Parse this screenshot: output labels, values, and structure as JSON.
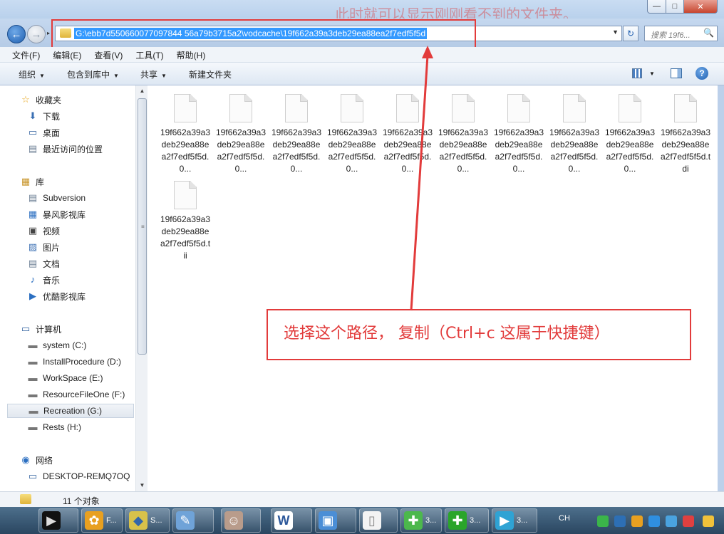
{
  "window": {
    "background_caption": "此时就可以显示刚刚看不到的文件夹。",
    "min_glyph": "—",
    "max_glyph": "□",
    "close_glyph": "✕"
  },
  "nav": {
    "back_glyph": "←",
    "forward_glyph": "→",
    "history_glyph": "▸",
    "address": "G:\\ebb7d550660077097844 56a79b3715a2\\vodcache\\19f662a39a3deb29ea88ea2f7edf5f5d",
    "address_dropdown": "▼",
    "refresh_glyph": "↻",
    "search_placeholder": "搜索 19f6...",
    "search_glyph": "🔍"
  },
  "menu": [
    "文件(F)",
    "编辑(E)",
    "查看(V)",
    "工具(T)",
    "帮助(H)"
  ],
  "toolbar": {
    "organize": "组织",
    "include_in_library": "包含到库中",
    "share": "共享",
    "new_folder": "新建文件夹",
    "arrow": "▼",
    "view_arrow": "▼",
    "help_glyph": "?"
  },
  "sidebar": {
    "favorites": {
      "label": "收藏夹",
      "icon": "☆"
    },
    "favorites_items": [
      {
        "label": "下载",
        "icon": "⬇"
      },
      {
        "label": "桌面",
        "icon": "▭"
      },
      {
        "label": "最近访问的位置",
        "icon": "▤"
      }
    ],
    "libraries": {
      "label": "库",
      "icon": "▦"
    },
    "library_items": [
      {
        "label": "Subversion",
        "icon": "▤"
      },
      {
        "label": "暴风影视库",
        "icon": "▦"
      },
      {
        "label": "视频",
        "icon": "▣"
      },
      {
        "label": "图片",
        "icon": "▨"
      },
      {
        "label": "文档",
        "icon": "▤"
      },
      {
        "label": "音乐",
        "icon": "♪"
      },
      {
        "label": "优酷影视库",
        "icon": "▶"
      }
    ],
    "computer": {
      "label": "计算机",
      "icon": "▭"
    },
    "drives": [
      {
        "label": "system (C:)",
        "icon": "▬"
      },
      {
        "label": "InstallProcedure (D:)",
        "icon": "▬"
      },
      {
        "label": "WorkSpace (E:)",
        "icon": "▬"
      },
      {
        "label": "ResourceFileOne (F:)",
        "icon": "▬"
      },
      {
        "label": "Recreation (G:)",
        "icon": "▬"
      },
      {
        "label": "Rests (H:)",
        "icon": "▬"
      }
    ],
    "network": {
      "label": "网络",
      "icon": "◉"
    },
    "network_items": [
      {
        "label": "DESKTOP-REMQ7OQ",
        "icon": "▭"
      }
    ],
    "scroll_up": "▲",
    "scroll_down": "▼",
    "scroll_grip": "≡"
  },
  "files": [
    "19f662a39a3deb29ea88ea2f7edf5f5d.0...",
    "19f662a39a3deb29ea88ea2f7edf5f5d.0...",
    "19f662a39a3deb29ea88ea2f7edf5f5d.0...",
    "19f662a39a3deb29ea88ea2f7edf5f5d.0...",
    "19f662a39a3deb29ea88ea2f7edf5f5d.0...",
    "19f662a39a3deb29ea88ea2f7edf5f5d.0...",
    "19f662a39a3deb29ea88ea2f7edf5f5d.0...",
    "19f662a39a3deb29ea88ea2f7edf5f5d.0...",
    "19f662a39a3deb29ea88ea2f7edf5f5d.0...",
    "19f662a39a3deb29ea88ea2f7edf5f5d.tdi",
    "19f662a39a3deb29ea88ea2f7edf5f5d.tii"
  ],
  "status": {
    "text": "11 个对象"
  },
  "annotation": {
    "text": "选择这个路径，  复制（Ctrl+c 这属于快捷键）",
    "color": "#e23b3b"
  },
  "taskbar": {
    "tasks": [
      {
        "label": "",
        "glyph": "▶"
      },
      {
        "label": "F...",
        "glyph": "✿"
      },
      {
        "label": "S...",
        "glyph": "◆"
      },
      {
        "label": "",
        "glyph": "✎"
      },
      {
        "label": "",
        "glyph": "☺"
      },
      {
        "label": "",
        "glyph": "W"
      },
      {
        "label": "",
        "glyph": "▣"
      },
      {
        "label": "",
        "glyph": "▯"
      },
      {
        "label": "3...",
        "glyph": "✚"
      },
      {
        "label": "3...",
        "glyph": "✚"
      },
      {
        "label": "3...",
        "glyph": "▶"
      }
    ],
    "tray_lang": "CH"
  }
}
